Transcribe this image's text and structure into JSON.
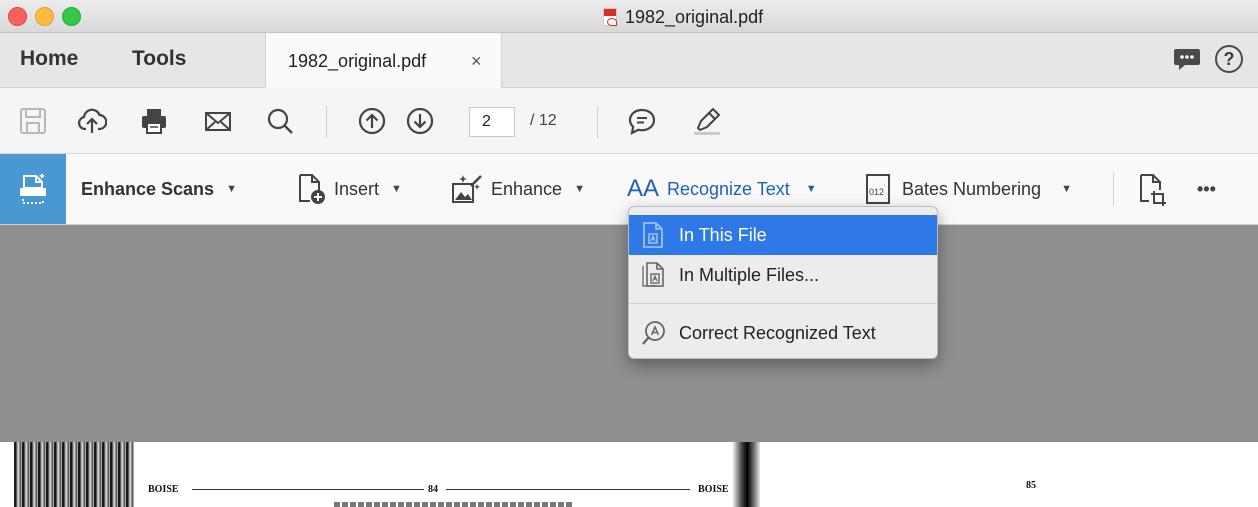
{
  "window": {
    "title": "1982_original.pdf"
  },
  "tabs": {
    "home": "Home",
    "tools": "Tools",
    "document": {
      "label": "1982_original.pdf",
      "close": "×"
    }
  },
  "toolbar": {
    "page_current": "2",
    "page_total": "/ 12"
  },
  "enhance_toolbar": {
    "title": "Enhance Scans",
    "insert": "Insert",
    "enhance": "Enhance",
    "recognize_glyph": "AA",
    "recognize": "Recognize Text",
    "bates": "Bates Numbering",
    "bates_glyph": "012",
    "more": "•••"
  },
  "menu": {
    "items": [
      {
        "label": "In This File",
        "active": true
      },
      {
        "label": "In Multiple Files..."
      },
      {
        "label": "Correct Recognized Text"
      }
    ]
  },
  "page": {
    "left_header": "BOISE",
    "left_page_no": "84",
    "right_header": "BOISE",
    "right_page_no": "85"
  },
  "colors": {
    "accent": "#4a98d2",
    "menu_highlight": "#2f79e6",
    "link_blue": "#1f5fbf",
    "doc_background": "#8f8f8f"
  },
  "icons": [
    "save-icon",
    "upload-icon",
    "print-icon",
    "mail-icon",
    "search-icon",
    "page-up-icon",
    "page-down-icon",
    "comment-icon",
    "highlight-pen-icon",
    "help-icon"
  ]
}
